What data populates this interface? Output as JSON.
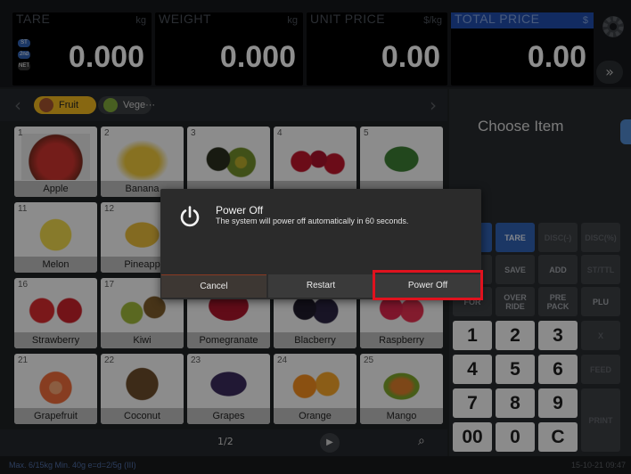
{
  "header": {
    "tare": {
      "label": "TARE",
      "unit": "kg",
      "value": "0.000",
      "badges": [
        "ST",
        "2nd",
        "NET"
      ]
    },
    "weight": {
      "label": "WEIGHT",
      "unit": "kg",
      "value": "0.000"
    },
    "unit_price": {
      "label": "UNIT PRICE",
      "unit": "$/kg",
      "value": "0.00"
    },
    "total_price": {
      "label": "TOTAL PRICE",
      "unit": "$",
      "value": "0.00"
    },
    "more_label": "»"
  },
  "categories": {
    "items": [
      {
        "label": "Fruit",
        "active": true
      },
      {
        "label": "Vege···",
        "active": false
      }
    ]
  },
  "grid": {
    "items": [
      {
        "num": "1",
        "name": "Apple",
        "color": "#c8332d"
      },
      {
        "num": "2",
        "name": "Banana",
        "color": "#e8c33a"
      },
      {
        "num": "3",
        "name": "",
        "color": "#4d6b2a"
      },
      {
        "num": "4",
        "name": "",
        "color": "#b8152a"
      },
      {
        "num": "5",
        "name": "",
        "color": "#3c7a32"
      },
      {
        "num": "11",
        "name": "Melon",
        "color": "#e9d24a"
      },
      {
        "num": "12",
        "name": "Pineapp",
        "color": "#e2b73a"
      },
      {
        "num": "",
        "name": "",
        "color": "#d9d9d9"
      },
      {
        "num": "",
        "name": "",
        "color": "#d9d9d9"
      },
      {
        "num": "",
        "name": "",
        "color": "#d9d9d9"
      },
      {
        "num": "16",
        "name": "Strawberry",
        "color": "#d32a2e"
      },
      {
        "num": "17",
        "name": "Kiwi",
        "color": "#7f8f2e"
      },
      {
        "num": "",
        "name": "Pomegranate",
        "color": "#a8162a"
      },
      {
        "num": "",
        "name": "Blacberry",
        "color": "#1e1a2a"
      },
      {
        "num": "",
        "name": "Raspberry",
        "color": "#d8254a"
      },
      {
        "num": "21",
        "name": "Grapefruit",
        "color": "#e86a3a"
      },
      {
        "num": "22",
        "name": "Coconut",
        "color": "#6a4a2a"
      },
      {
        "num": "23",
        "name": "Grapes",
        "color": "#3a2a5a"
      },
      {
        "num": "24",
        "name": "Orange",
        "color": "#ee8a1e"
      },
      {
        "num": "25",
        "name": "Mango",
        "color": "#d87a2a"
      }
    ]
  },
  "pager": {
    "text": "1/2"
  },
  "right": {
    "choose_label": "Choose Item",
    "keys": [
      {
        "label": "",
        "style": "blue"
      },
      {
        "label": "TARE",
        "style": "blue"
      },
      {
        "label": "DISC(-)",
        "style": "dim"
      },
      {
        "label": "DISC(%)",
        "style": "dim"
      },
      {
        "label": "O",
        "style": "normal"
      },
      {
        "label": "SAVE",
        "style": "normal"
      },
      {
        "label": "ADD",
        "style": "normal"
      },
      {
        "label": "ST/TTL",
        "style": "dim"
      },
      {
        "label": "FOR",
        "style": "normal"
      },
      {
        "label": "OVER RIDE",
        "style": "normal"
      },
      {
        "label": "PRE PACK",
        "style": "normal"
      },
      {
        "label": "PLU",
        "style": "normal"
      },
      {
        "label": "1",
        "style": "num"
      },
      {
        "label": "2",
        "style": "num"
      },
      {
        "label": "3",
        "style": "num"
      },
      {
        "label": "X",
        "style": "dim"
      },
      {
        "label": "4",
        "style": "num"
      },
      {
        "label": "5",
        "style": "num"
      },
      {
        "label": "6",
        "style": "num"
      },
      {
        "label": "FEED",
        "style": "dim"
      },
      {
        "label": "7",
        "style": "num"
      },
      {
        "label": "8",
        "style": "num"
      },
      {
        "label": "9",
        "style": "num"
      },
      {
        "label": "PRINT",
        "style": "dim"
      },
      {
        "label": "00",
        "style": "num"
      },
      {
        "label": "0",
        "style": "num"
      },
      {
        "label": "C",
        "style": "num"
      }
    ]
  },
  "status": {
    "left": "Max. 6/15kg  Min. 40g  e=d=2/5g  (III)",
    "right": "15-10-21 09:47"
  },
  "dialog": {
    "title": "Power Off",
    "message": "The system will power off automatically in 60 seconds.",
    "buttons": {
      "cancel": "Cancel",
      "restart": "Restart",
      "power_off": "Power Off"
    }
  },
  "colors": {
    "accent": "#2f5fae",
    "highlight": "#e0121e"
  }
}
